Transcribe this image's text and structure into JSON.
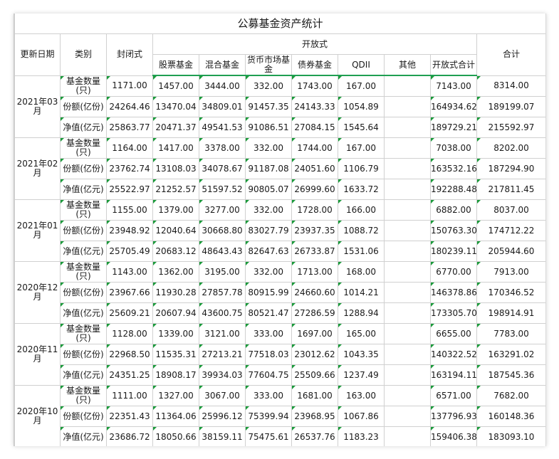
{
  "title": "公募基金资产统计",
  "headers": {
    "date": "更新日期",
    "category": "类别",
    "closed": "封闭式",
    "open": "开放式",
    "total": "合计",
    "open_sub": [
      "股票基金",
      "混合基金",
      "货币市场基金",
      "债券基金",
      "QDII",
      "其他",
      "开放式合计"
    ]
  },
  "groups": [
    {
      "date": "2021年03月",
      "rows": [
        {
          "category": "基金数量(只)",
          "values": [
            "1171.00",
            "1457.00",
            "3444.00",
            "332.00",
            "1743.00",
            "167.00",
            "",
            "7143.00",
            "8314.00"
          ]
        },
        {
          "category": "份额(亿份)",
          "values": [
            "24264.46",
            "13470.04",
            "34809.01",
            "91457.35",
            "24143.33",
            "1054.89",
            "",
            "164934.62",
            "189199.07"
          ]
        },
        {
          "category": "净值(亿元)",
          "values": [
            "25863.77",
            "20471.37",
            "49541.53",
            "91086.51",
            "27084.15",
            "1545.64",
            "",
            "189729.21",
            "215592.97"
          ]
        }
      ]
    },
    {
      "date": "2021年02月",
      "rows": [
        {
          "category": "基金数量(只)",
          "values": [
            "1164.00",
            "1417.00",
            "3378.00",
            "332.00",
            "1744.00",
            "167.00",
            "",
            "7038.00",
            "8202.00"
          ]
        },
        {
          "category": "份额(亿份)",
          "values": [
            "23762.74",
            "13108.03",
            "34078.67",
            "91187.08",
            "24051.60",
            "1106.79",
            "",
            "163532.16",
            "187294.90"
          ]
        },
        {
          "category": "净值(亿元)",
          "values": [
            "25522.97",
            "21252.57",
            "51597.52",
            "90805.07",
            "26999.60",
            "1633.72",
            "",
            "192288.48",
            "217811.45"
          ]
        }
      ]
    },
    {
      "date": "2021年01月",
      "rows": [
        {
          "category": "基金数量(只)",
          "values": [
            "1155.00",
            "1379.00",
            "3277.00",
            "332.00",
            "1728.00",
            "166.00",
            "",
            "6882.00",
            "8037.00"
          ]
        },
        {
          "category": "份额(亿份)",
          "values": [
            "23948.92",
            "12040.64",
            "30668.80",
            "83027.79",
            "23937.35",
            "1088.72",
            "",
            "150763.30",
            "174712.22"
          ]
        },
        {
          "category": "净值(亿元)",
          "values": [
            "25705.49",
            "20683.12",
            "48643.43",
            "82647.63",
            "26733.87",
            "1531.06",
            "",
            "180239.11",
            "205944.60"
          ]
        }
      ]
    },
    {
      "date": "2020年12月",
      "rows": [
        {
          "category": "基金数量(只)",
          "values": [
            "1143.00",
            "1362.00",
            "3195.00",
            "332.00",
            "1713.00",
            "168.00",
            "",
            "6770.00",
            "7913.00"
          ]
        },
        {
          "category": "份额(亿份)",
          "values": [
            "23967.66",
            "11930.28",
            "27857.78",
            "80915.99",
            "24660.60",
            "1014.21",
            "",
            "146378.86",
            "170346.52"
          ]
        },
        {
          "category": "净值(亿元)",
          "values": [
            "25609.21",
            "20607.94",
            "43600.75",
            "80521.47",
            "27286.59",
            "1288.94",
            "",
            "173305.70",
            "198914.91"
          ]
        }
      ]
    },
    {
      "date": "2020年11月",
      "rows": [
        {
          "category": "基金数量(只)",
          "values": [
            "1128.00",
            "1339.00",
            "3121.00",
            "333.00",
            "1697.00",
            "165.00",
            "",
            "6655.00",
            "7783.00"
          ]
        },
        {
          "category": "份额(亿份)",
          "values": [
            "22968.50",
            "11535.31",
            "27213.21",
            "77518.03",
            "23012.62",
            "1043.35",
            "",
            "140322.52",
            "163291.02"
          ]
        },
        {
          "category": "净值(亿元)",
          "values": [
            "24351.25",
            "18908.17",
            "39934.03",
            "77604.75",
            "25509.66",
            "1237.49",
            "",
            "163194.11",
            "187545.36"
          ]
        }
      ]
    },
    {
      "date": "2020年10月",
      "rows": [
        {
          "category": "基金数量(只)",
          "values": [
            "1111.00",
            "1327.00",
            "3067.00",
            "333.00",
            "1681.00",
            "163.00",
            "",
            "6571.00",
            "7682.00"
          ]
        },
        {
          "category": "份额(亿份)",
          "values": [
            "22351.43",
            "11364.06",
            "25996.12",
            "75399.94",
            "23968.95",
            "1067.86",
            "",
            "137796.93",
            "160148.36"
          ]
        },
        {
          "category": "净值(亿元)",
          "values": [
            "23686.72",
            "18050.66",
            "38159.11",
            "75475.61",
            "26537.76",
            "1183.23",
            "",
            "159406.38",
            "183093.10"
          ]
        }
      ]
    }
  ]
}
